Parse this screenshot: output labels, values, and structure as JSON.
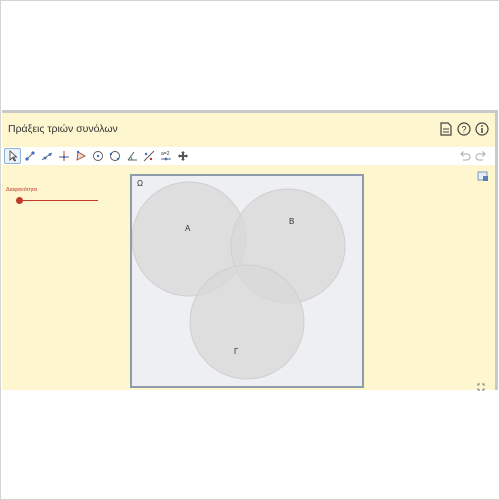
{
  "app": {
    "title": "Πράξεις τριών συνόλων"
  },
  "toolbar": {
    "tools": [
      "move-tool",
      "point-tool",
      "line-tool",
      "perpendicular-tool",
      "polygon-tool",
      "circle-tool",
      "circle-arc-tool",
      "angle-tool",
      "reflect-tool",
      "slider-tool",
      "move-view-tool"
    ],
    "active_tool": "move-tool"
  },
  "algebra": {
    "slider_label": "Διαφανότητα"
  },
  "graphics": {
    "universe_label": "Ω",
    "sets": [
      {
        "label": "A"
      },
      {
        "label": "B"
      },
      {
        "label": "Γ"
      }
    ],
    "circle_fill": "#d9d9d9",
    "circle_stroke": "#cfcfcf"
  },
  "colors": {
    "app_background": "#fdf6cf",
    "graphics_background": "#eeeff2",
    "graphics_border": "#8e9bab",
    "slider_color": "#c0392b"
  }
}
